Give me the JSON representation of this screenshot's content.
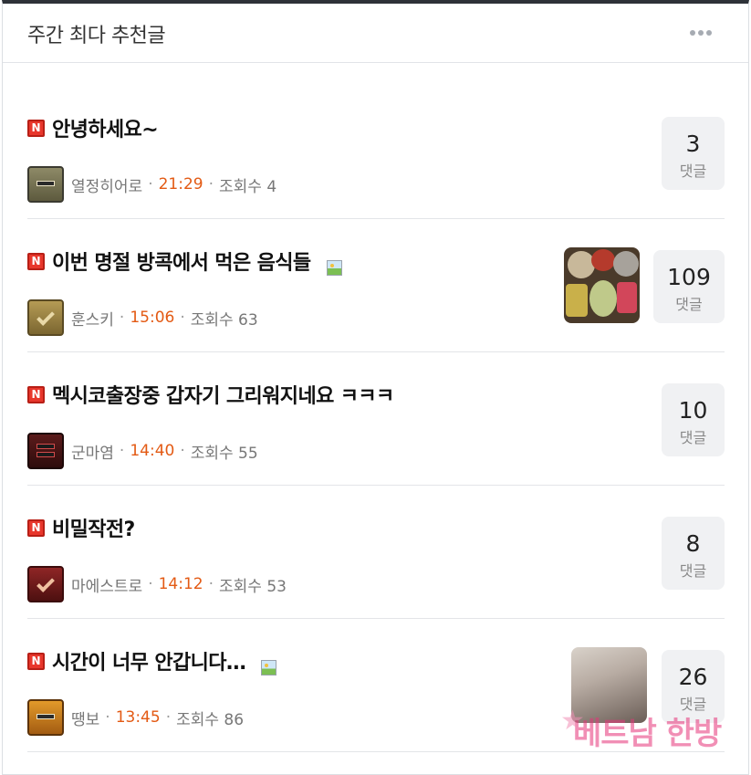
{
  "header": {
    "title": "주간 최다 추천글",
    "more_icon": "more-dots-icon"
  },
  "badge_letter": "N",
  "reply_label": "댓글",
  "posts": [
    {
      "title": "안녕하세요~",
      "author": "열정히어로",
      "time": "21:29",
      "views": "조회수 4",
      "replies": "3",
      "has_image": false,
      "level_icon": "level-badge-icon"
    },
    {
      "title": "이번 명절 방콕에서 먹은 음식들",
      "author": "훈스키",
      "time": "15:06",
      "views": "조회수 63",
      "replies": "109",
      "has_image": true,
      "level_icon": "level-badge-icon"
    },
    {
      "title": "멕시코출장중 갑자기 그리워지네요 ㅋㅋㅋ",
      "author": "군마염",
      "time": "14:40",
      "views": "조회수 55",
      "replies": "10",
      "has_image": false,
      "level_icon": "level-badge-icon"
    },
    {
      "title": "비밀작전?",
      "author": "마에스트로",
      "time": "14:12",
      "views": "조회수 53",
      "replies": "8",
      "has_image": false,
      "level_icon": "level-badge-icon"
    },
    {
      "title": "시간이 너무 안갑니다…",
      "author": "땡보",
      "time": "13:45",
      "views": "조회수 86",
      "replies": "26",
      "has_image": true,
      "level_icon": "level-badge-icon"
    }
  ],
  "watermark": {
    "text": "베트남 한방"
  },
  "colors": {
    "time": "#e35a14",
    "badge": "#e8372c",
    "header_border": "#2e3238"
  }
}
